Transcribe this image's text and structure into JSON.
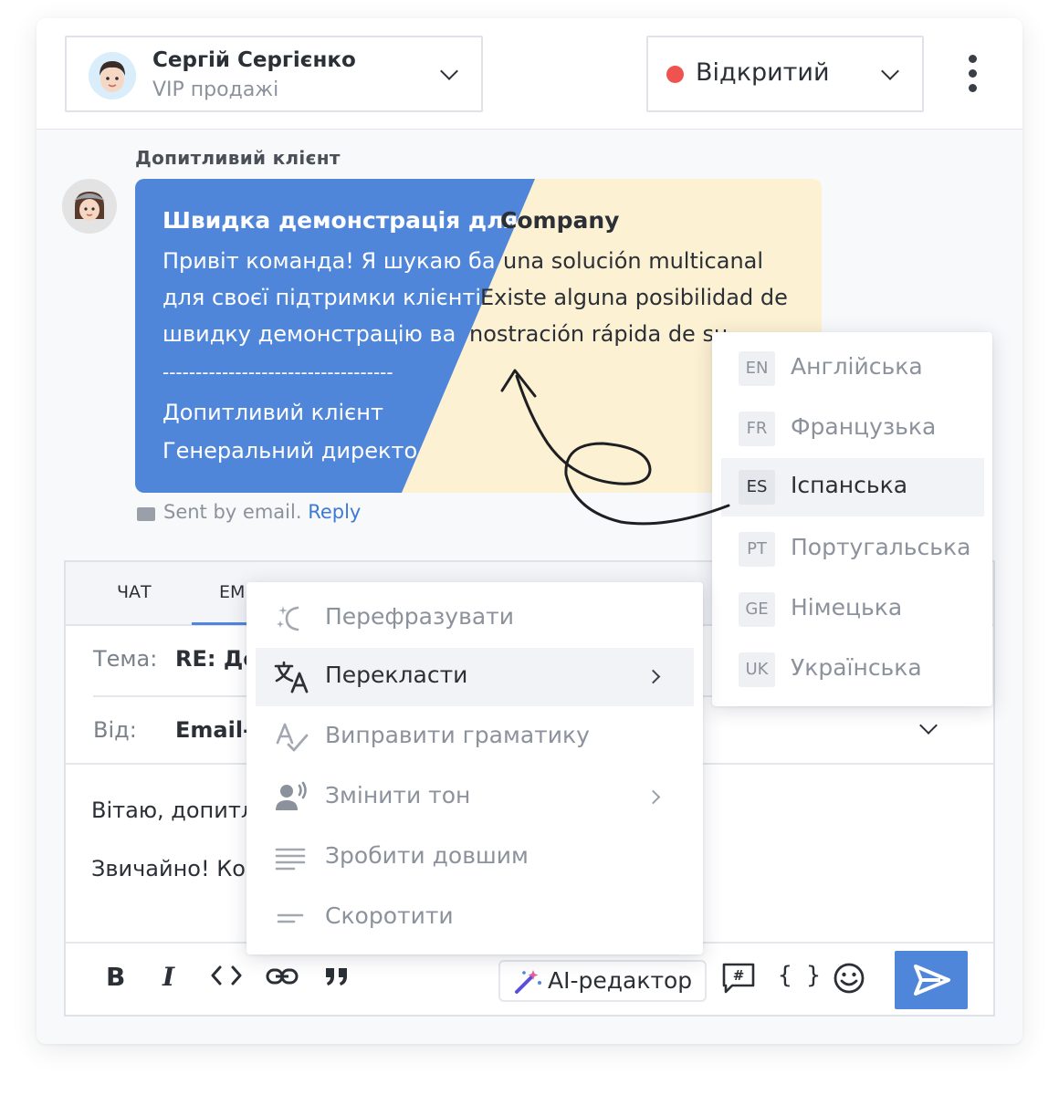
{
  "header": {
    "agent_name": "Сергій Сергієнко",
    "agent_team": "VIP продажі",
    "status_label": "Відкритий",
    "status_color": "#ef5350"
  },
  "message": {
    "sender_label": "Допитливий клієнт",
    "title_original": "Швидка демонстрація для ",
    "title_translated": "Company",
    "original_lines": [
      "Привіт команда! Я шукаю ба",
      "для своєї підтримки клієнті",
      "швидку демонстрацію ва",
      "-----------------------------------",
      "Допитливий клієнт",
      "Генеральний директо"
    ],
    "translated_lines": [
      "una solución multicanal",
      "Existe alguna posibilidad de",
      "nostración rápida de su"
    ],
    "sent_text": "Sent by email.",
    "reply_link": "Reply",
    "original_bg": "#4f86d9",
    "translated_bg": "#fdf1d3"
  },
  "composer": {
    "tabs": [
      "ЧАТ",
      "ЕМ"
    ],
    "subject_label": "Тема:",
    "subject_value": "RE: Де",
    "from_label": "Від:",
    "from_value": "Email-",
    "body_lines": [
      "Вітаю, допитл",
      "Звичайно! Ко"
    ],
    "ai_editor_label": "AI-редактор"
  },
  "ai_menu": {
    "items": [
      {
        "label": "Перефразувати",
        "icon": "sparkle-rephrase-icon"
      },
      {
        "label": "Перекласти",
        "icon": "translate-icon"
      },
      {
        "label": "Виправити граматику",
        "icon": "spellcheck-icon"
      },
      {
        "label": "Змінити тон",
        "icon": "voice-tone-icon"
      },
      {
        "label": "Зробити довшим",
        "icon": "lengthen-icon"
      },
      {
        "label": "Скоротити",
        "icon": "shorten-icon"
      }
    ]
  },
  "lang_menu": {
    "items": [
      {
        "code": "EN",
        "label": "Англійська"
      },
      {
        "code": "FR",
        "label": "Французька"
      },
      {
        "code": "ES",
        "label": "Іспанська"
      },
      {
        "code": "PT",
        "label": "Португальська"
      },
      {
        "code": "GE",
        "label": "Німецька"
      },
      {
        "code": "UK",
        "label": "Українська"
      }
    ]
  }
}
